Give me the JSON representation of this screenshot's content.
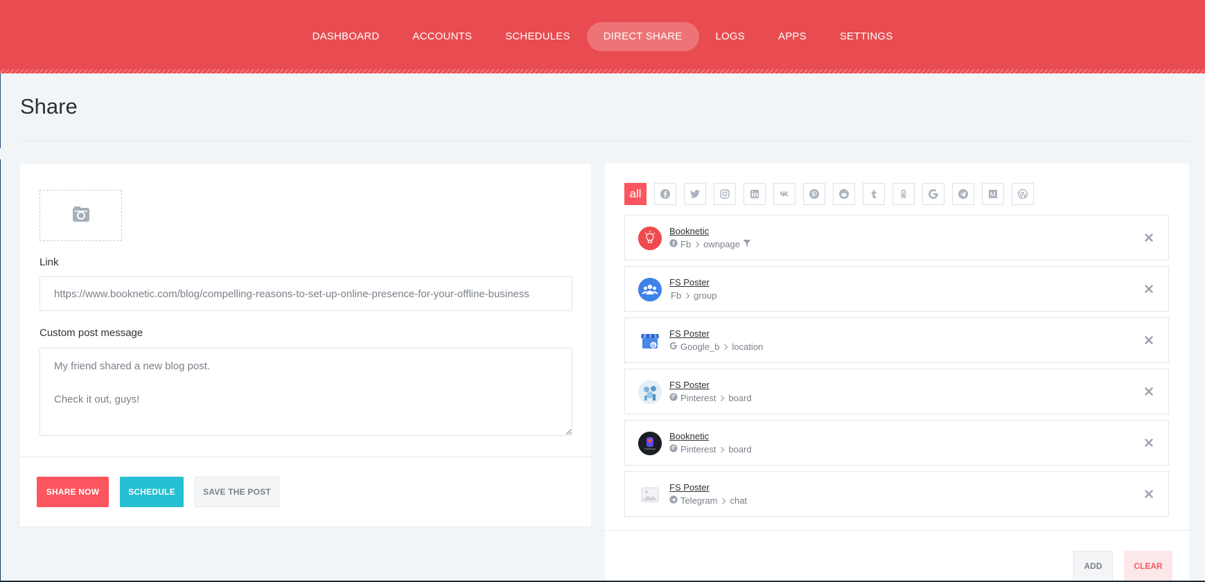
{
  "nav": {
    "items": [
      {
        "label": "DASHBOARD"
      },
      {
        "label": "ACCOUNTS"
      },
      {
        "label": "SCHEDULES"
      },
      {
        "label": "DIRECT SHARE",
        "active": true
      },
      {
        "label": "LOGS"
      },
      {
        "label": "APPS"
      },
      {
        "label": "SETTINGS"
      }
    ]
  },
  "page": {
    "title": "Share"
  },
  "form": {
    "image_icon": "camera-icon",
    "link_label": "Link",
    "link_value": "https://www.booknetic.com/blog/compelling-reasons-to-set-up-online-presence-for-your-offline-business",
    "message_label": "Custom post message",
    "message_value": "My friend shared a new blog post.\n\nCheck it out, guys!",
    "buttons": {
      "share_now": "SHARE NOW",
      "schedule": "SCHEDULE",
      "save_post": "SAVE THE POST"
    }
  },
  "filters": {
    "all_label": "all",
    "icons": [
      "facebook-icon",
      "twitter-icon",
      "instagram-icon",
      "linkedin-icon",
      "vk-icon",
      "pinterest-icon",
      "reddit-icon",
      "tumblr-icon",
      "odnoklassniki-icon",
      "google-icon",
      "telegram-icon",
      "medium-icon",
      "wordpress-icon"
    ]
  },
  "accounts": [
    {
      "name": "Booknetic",
      "network": "Fb",
      "type": "ownpage",
      "network_icon": "facebook-icon",
      "has_filter": true
    },
    {
      "name": "FS Poster",
      "network": "Fb",
      "type": "group",
      "network_icon": "",
      "has_filter": false
    },
    {
      "name": "FS Poster",
      "network": "Google_b",
      "type": "location",
      "network_icon": "google-icon",
      "has_filter": false
    },
    {
      "name": "FS Poster",
      "network": "Pinterest",
      "type": "board",
      "network_icon": "pinterest-icon",
      "has_filter": false
    },
    {
      "name": "Booknetic",
      "network": "Pinterest",
      "type": "board",
      "network_icon": "pinterest-icon",
      "has_filter": false
    },
    {
      "name": "FS Poster",
      "network": "Telegram",
      "type": "chat",
      "network_icon": "telegram-icon",
      "has_filter": false
    }
  ],
  "right_buttons": {
    "add": "ADD",
    "clear": "CLEAR"
  },
  "colors": {
    "brand": "#e84c50",
    "primary": "#fb5660",
    "info": "#26bfd3"
  }
}
